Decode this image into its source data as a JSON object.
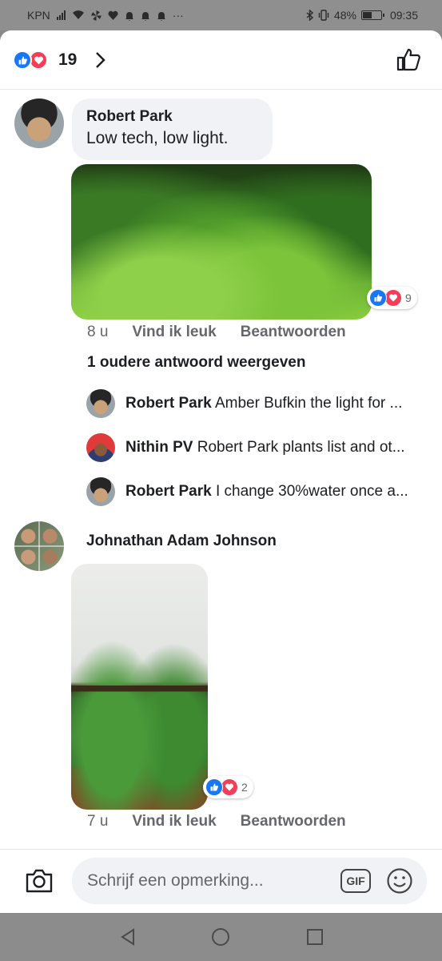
{
  "status_bar": {
    "carrier": "KPN",
    "icons": [
      "signal-icon",
      "wifi-icon",
      "pinwheel-icon",
      "heart-icon",
      "bell-icon",
      "bell-icon",
      "bell-icon",
      "more-icon"
    ],
    "dots": "···",
    "battery_percent": "48%",
    "time": "09:35"
  },
  "reactions": {
    "count": "19",
    "types": [
      "like",
      "love"
    ]
  },
  "comments": [
    {
      "author": "Robert Park",
      "text": "Low tech, low light.",
      "image_desc": "planted-aquarium-photo",
      "reaction_count": "9",
      "time": "8 u",
      "like_label": "Vind ik leuk",
      "reply_label": "Beantwoorden"
    },
    {
      "author": "Johnathan Adam Johnson",
      "image_desc": "aquarium-tank-photo",
      "reaction_count": "2",
      "time": "7 u",
      "like_label": "Vind ik leuk",
      "reply_label": "Beantwoorden"
    }
  ],
  "older_replies_label": "1 oudere antwoord weergeven",
  "replies": [
    {
      "author": "Robert Park",
      "text": "Amber Bufkin the light for ..."
    },
    {
      "author": "Nithin PV",
      "text": "Robert Park plants list and ot..."
    },
    {
      "author": "Robert Park",
      "text": "I change 30%water once a..."
    }
  ],
  "composer": {
    "placeholder": "Schrijf een opmerking...",
    "gif_label": "GIF"
  },
  "colors": {
    "like_blue": "#1877f2",
    "love_red": "#f33e58",
    "bubble_bg": "#f0f2f5"
  }
}
